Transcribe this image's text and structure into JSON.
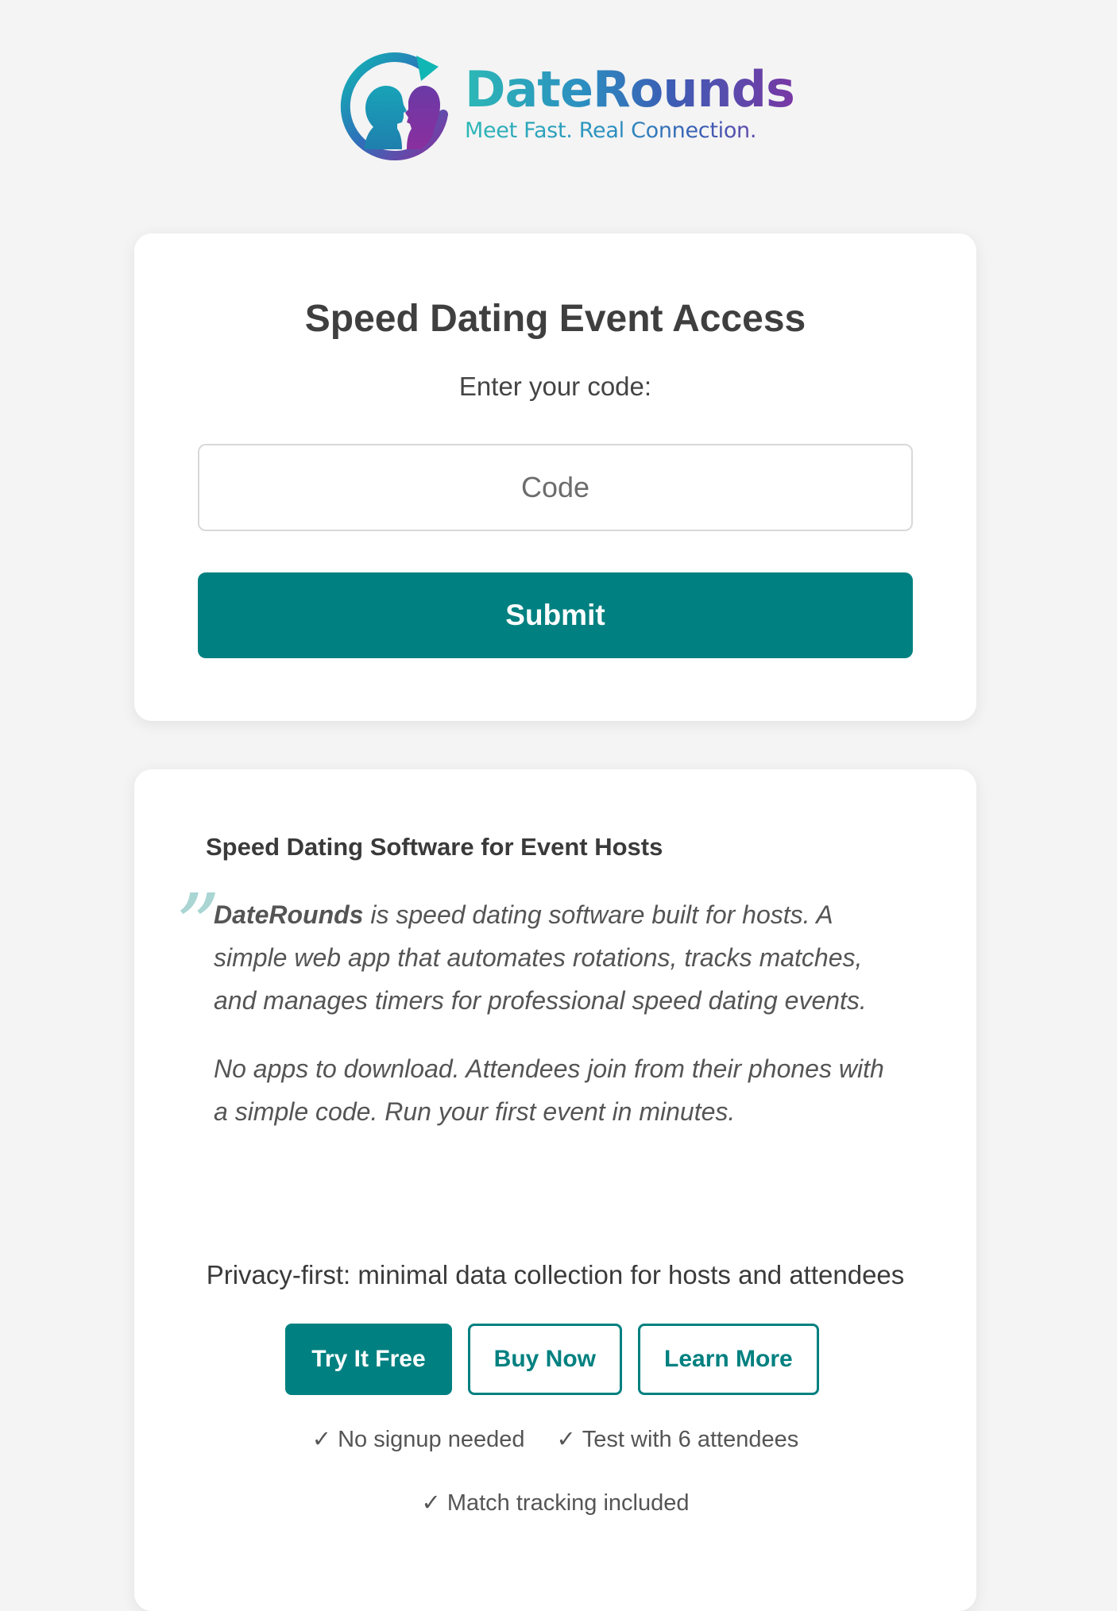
{
  "brand": {
    "name": "DateRounds",
    "tagline": "Meet Fast. Real Connection."
  },
  "access": {
    "title": "Speed Dating Event Access",
    "subtitle": "Enter your code:",
    "code_placeholder": "Code",
    "code_value": "",
    "submit_label": "Submit"
  },
  "info": {
    "heading": "Speed Dating Software for Event Hosts",
    "quote_mark": "”",
    "quote_brand": "DateRounds",
    "quote_p1_rest": " is speed dating software built for hosts. A simple web app that automates rotations, tracks matches, and manages timers for professional speed dating events.",
    "quote_p2": "No apps to download. Attendees join from their phones with a simple code. Run your first event in minutes.",
    "privacy": "Privacy-first: minimal data collection for hosts and attendees",
    "buttons": {
      "try_free": "Try It Free",
      "buy_now": "Buy Now",
      "learn_more": "Learn More"
    },
    "check_glyph": "✓",
    "features": [
      "No signup needed",
      "Test with 6 attendees",
      "Match tracking included"
    ]
  },
  "colors": {
    "accent": "#008080",
    "background": "#f4f4f4",
    "card": "#ffffff",
    "brand_gradient": [
      "#2cb8b6",
      "#3a5fb5",
      "#7a36a4"
    ]
  }
}
